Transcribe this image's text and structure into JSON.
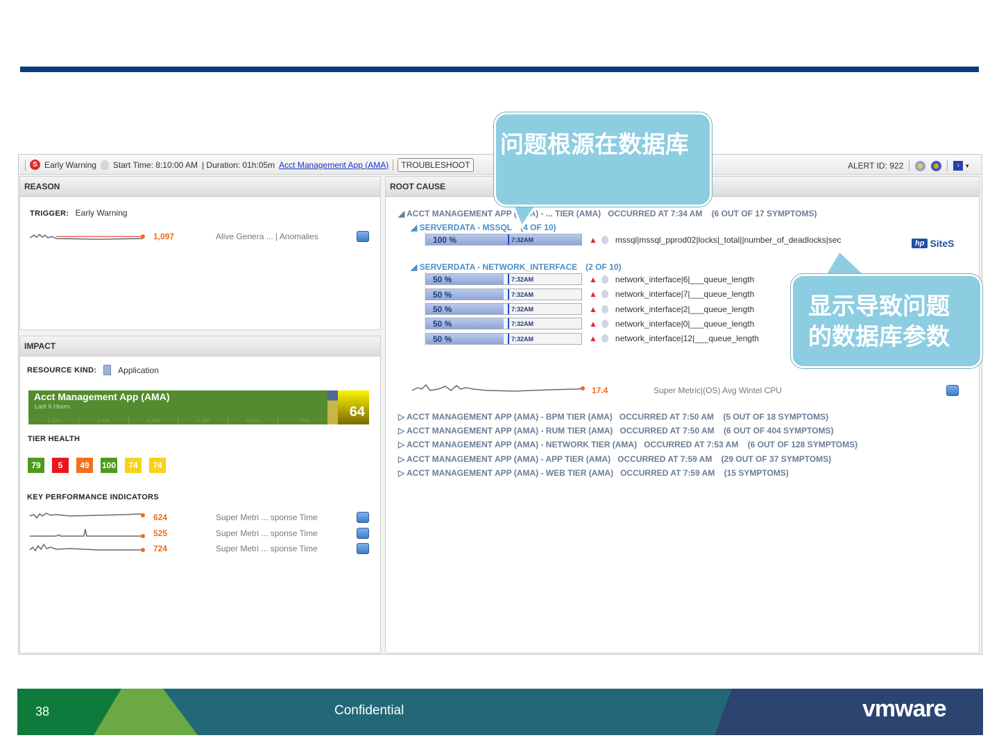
{
  "toolbar": {
    "severity": "Early Warning",
    "start_time": "Start Time: 8:10:00 AM",
    "duration": "| Duration: 01h:05m",
    "app_link": "Acct Management App (AMA)",
    "troubleshoot": "TROUBLESHOOT",
    "alert_id": "ALERT ID: 922"
  },
  "reason": {
    "header": "REASON",
    "trigger_label": "TRIGGER:",
    "trigger_value": "Early Warning",
    "metric_value": "1,097",
    "metric_name": "Alive Genera ... | Anomalies"
  },
  "impact": {
    "header": "IMPACT",
    "resource_kind_label": "RESOURCE KIND:",
    "resource_kind_value": "Application",
    "health_title": "Acct Management App (AMA)",
    "health_subtitle": "Last 6 Hours",
    "health_hours": [
      "2 AM",
      "3 AM",
      "4 AM",
      "5 AM",
      "6 AM",
      "7 AM"
    ],
    "health_score": "64",
    "tier_health_label": "TIER HEALTH",
    "tiers": [
      {
        "value": "79",
        "color": "#4e9a1c"
      },
      {
        "value": "5",
        "color": "#e8171c"
      },
      {
        "value": "49",
        "color": "#f2701e"
      },
      {
        "value": "100",
        "color": "#4e9a1c"
      },
      {
        "value": "74",
        "color": "#f7d21a"
      },
      {
        "value": "74",
        "color": "#f7d21a"
      }
    ],
    "kpi_label": "KEY PERFORMANCE INDICATORS",
    "kpis": [
      {
        "value": "624",
        "name": "Super Metri ... sponse Time"
      },
      {
        "value": "525",
        "name": "Super Metri ... sponse Time"
      },
      {
        "value": "724",
        "name": "Super Metri ... sponse Time"
      }
    ]
  },
  "root_cause": {
    "header": "ROOT CAUSE",
    "main": "ACCT MANAGEMENT APP (AMA) - ... TIER (AMA)   OCCURRED AT 7:34 AM    (6 OUT OF 17 SYMPTOMS)",
    "groups": [
      {
        "name": "SERVERDATA - MSSQL",
        "count": "(4 OF 10)",
        "rows": [
          {
            "pct": "100 %",
            "fill": 100,
            "time": "7:32AM",
            "metric": "mssql|mssql_pprod02|locks|_total||number_of_deadlocks|sec"
          }
        ]
      },
      {
        "name": "SERVERDATA - NETWORK_INTERFACE",
        "count": "(2 OF 10)",
        "rows": [
          {
            "pct": "50 %",
            "fill": 50,
            "time": "7:32AM",
            "metric": "network_interface|6|___queue_length"
          },
          {
            "pct": "50 %",
            "fill": 50,
            "time": "7:32AM",
            "metric": "network_interface|7|___queue_length"
          },
          {
            "pct": "50 %",
            "fill": 50,
            "time": "7:32AM",
            "metric": "network_interface|2|___queue_length"
          },
          {
            "pct": "50 %",
            "fill": 50,
            "time": "7:32AM",
            "metric": "network_interface|0|___queue_length"
          },
          {
            "pct": "50 %",
            "fill": 50,
            "time": "7:32AM",
            "metric": "network_interface|12|___queue_length"
          }
        ]
      }
    ],
    "cpu_value": "17.4",
    "cpu_name": "Super Metric|(OS) Avg Wintel CPU",
    "logo": "SiteS",
    "other": [
      "ACCT MANAGEMENT APP (AMA) - BPM TIER (AMA)   OCCURRED AT 7:50 AM    (5 OUT OF 18 SYMPTOMS)",
      "ACCT MANAGEMENT APP (AMA) - RUM TIER (AMA)   OCCURRED AT 7:50 AM    (6 OUT OF 404 SYMPTOMS)",
      "ACCT MANAGEMENT APP (AMA) - NETWORK TIER (AMA)   OCCURRED AT 7:53 AM    (6 OUT OF 128 SYMPTOMS)",
      "ACCT MANAGEMENT APP (AMA) - APP TIER (AMA)   OCCURRED AT 7:59 AM    (29 OUT OF 37 SYMPTOMS)",
      "ACCT MANAGEMENT APP (AMA) - WEB TIER (AMA)   OCCURRED AT 7:59 AM    (15 SYMPTOMS)"
    ]
  },
  "callouts": {
    "one": "问题根源在数据库",
    "two": "显示导致问题的数据库参数"
  },
  "footer": {
    "page": "38",
    "confidential": "Confidential",
    "logo": "vmware"
  }
}
